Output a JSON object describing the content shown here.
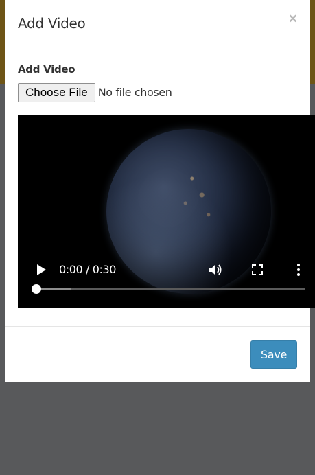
{
  "modal": {
    "title": "Add Video",
    "close_label": "×"
  },
  "form": {
    "field_label": "Add Video",
    "choose_file_label": "Choose File",
    "file_status": "No file chosen"
  },
  "video_player": {
    "time_display": "0:00 / 0:30",
    "current_time": "0:00",
    "duration": "0:30",
    "progress_fraction": 0.0,
    "buffered_fraction": 0.13,
    "icons": [
      "play-icon",
      "volume-icon",
      "fullscreen-icon",
      "more-options-icon"
    ]
  },
  "footer": {
    "save_label": "Save"
  },
  "colors": {
    "primary_button": "#3c8dbc",
    "backdrop": "#58595b",
    "backdrop_top": "#6e5516"
  }
}
